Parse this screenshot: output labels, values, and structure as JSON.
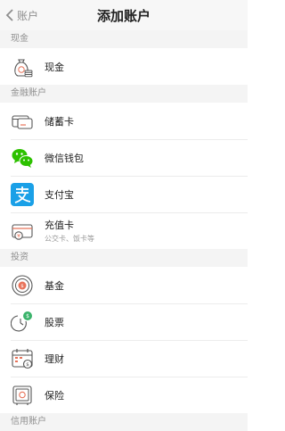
{
  "nav": {
    "back_label": "账户",
    "title": "添加账户"
  },
  "sections": {
    "cash": "现金",
    "finance": "金融账户",
    "invest": "投资",
    "credit": "信用账户"
  },
  "items": {
    "cash": {
      "label": "现金"
    },
    "debit_card": {
      "label": "储蓄卡"
    },
    "wechat_wallet": {
      "label": "微信钱包"
    },
    "alipay": {
      "label": "支付宝"
    },
    "prepaid_card": {
      "label": "充值卡",
      "sub": "公交卡、饭卡等"
    },
    "fund": {
      "label": "基金"
    },
    "stock": {
      "label": "股票"
    },
    "wealth": {
      "label": "理财"
    },
    "insurance": {
      "label": "保险"
    }
  },
  "colors": {
    "wechat_green": "#2dc100",
    "alipay_blue": "#1aa0e7",
    "accent_orange": "#e8735a",
    "stock_green": "#3bb36b"
  }
}
